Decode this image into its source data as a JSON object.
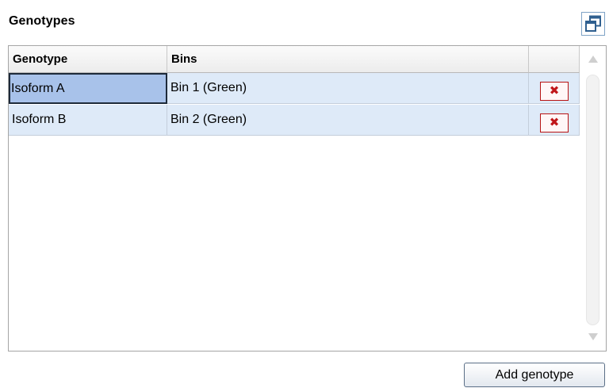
{
  "section": {
    "title": "Genotypes",
    "popout_icon": "popout-window-icon"
  },
  "table": {
    "columns": [
      "Genotype",
      "Bins",
      ""
    ],
    "rows": [
      {
        "genotype": "Isoform A",
        "bins": "Bin 1 (Green)",
        "delete_icon": "delete-icon"
      },
      {
        "genotype": "Isoform B",
        "bins": "Bin 2 (Green)",
        "delete_icon": "delete-icon"
      }
    ],
    "selected_cell": "Isoform A"
  },
  "actions": {
    "add_label": "Add genotype"
  },
  "colors": {
    "row_background": "#deeaf8",
    "selected_cell": "#a8c2ea",
    "delete_icon": "#c0171b",
    "panel_border": "#a5a5a5"
  }
}
